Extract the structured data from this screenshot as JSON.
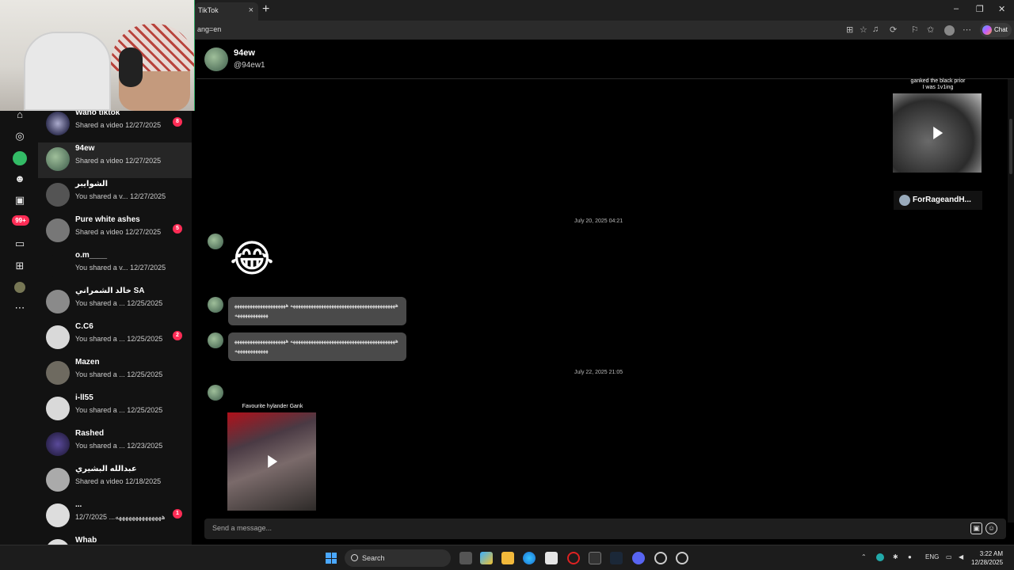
{
  "browser": {
    "tab_title": "TikTok",
    "tab_close": "×",
    "new_tab": "+",
    "url": "ang=en",
    "chat_label": "Chat",
    "win_min": "–",
    "win_max": "❐",
    "win_close": "✕"
  },
  "rail": {
    "notifications_badge": "99+"
  },
  "conversations": [
    {
      "name": "Wano tiktok",
      "sub": "Shared a video",
      "date": "12/27/2025",
      "badge": "8"
    },
    {
      "name": "94ew",
      "sub": "Shared a video",
      "date": "12/27/2025",
      "badge": ""
    },
    {
      "name": "الشوايبر",
      "sub": "You shared a v...",
      "date": "12/27/2025",
      "badge": ""
    },
    {
      "name": "Pure white ashes",
      "sub": "Shared a video",
      "date": "12/27/2025",
      "badge": "5"
    },
    {
      "name": "o.m____",
      "sub": "You shared a v...",
      "date": "12/27/2025",
      "badge": ""
    },
    {
      "name": "خالد الشمراني SA",
      "sub": "You shared a ...",
      "date": "12/25/2025",
      "badge": ""
    },
    {
      "name": "C.C6",
      "sub": "You shared a ...",
      "date": "12/25/2025",
      "badge": "2"
    },
    {
      "name": "Mazen",
      "sub": "You shared a ...",
      "date": "12/25/2025",
      "badge": ""
    },
    {
      "name": "i-ll55",
      "sub": "You shared a ...",
      "date": "12/25/2025",
      "badge": ""
    },
    {
      "name": "Rashed",
      "sub": "You shared a ...",
      "date": "12/23/2025",
      "badge": ""
    },
    {
      "name": "عبدالله البشيري",
      "sub": "Shared a video",
      "date": "12/18/2025",
      "badge": ""
    },
    {
      "name": "...",
      "sub": "ههههههههههههههه...",
      "date": "12/7/2025",
      "badge": "1"
    },
    {
      "name": "Whab",
      "sub": "",
      "date": "",
      "badge": ""
    }
  ],
  "chat": {
    "name": "94ew",
    "handle": "@94ew1",
    "video1": {
      "caption": "ganked the black prior\nI was 1v1ing",
      "author": "ForRageandH..."
    },
    "time1": "July 20, 2025 04:21",
    "emoji": "😂",
    "bubble1": "هههههههههههههههههههههههههههههههههههههههههه هههههههههههههههههههههههههههههههههه",
    "bubble2": "هههههههههههههههههههههههههههههههههههههههههه هههههههههههههههههههههههههههههههههه",
    "time2": "July 22, 2025 21:05",
    "video2": {
      "caption": "Favourite hylander Gank"
    },
    "composer_placeholder": "Send a message..."
  },
  "taskbar": {
    "search_label": "Search",
    "lang": "ENG",
    "time": "3:22 AM",
    "date": "12/28/2025"
  }
}
